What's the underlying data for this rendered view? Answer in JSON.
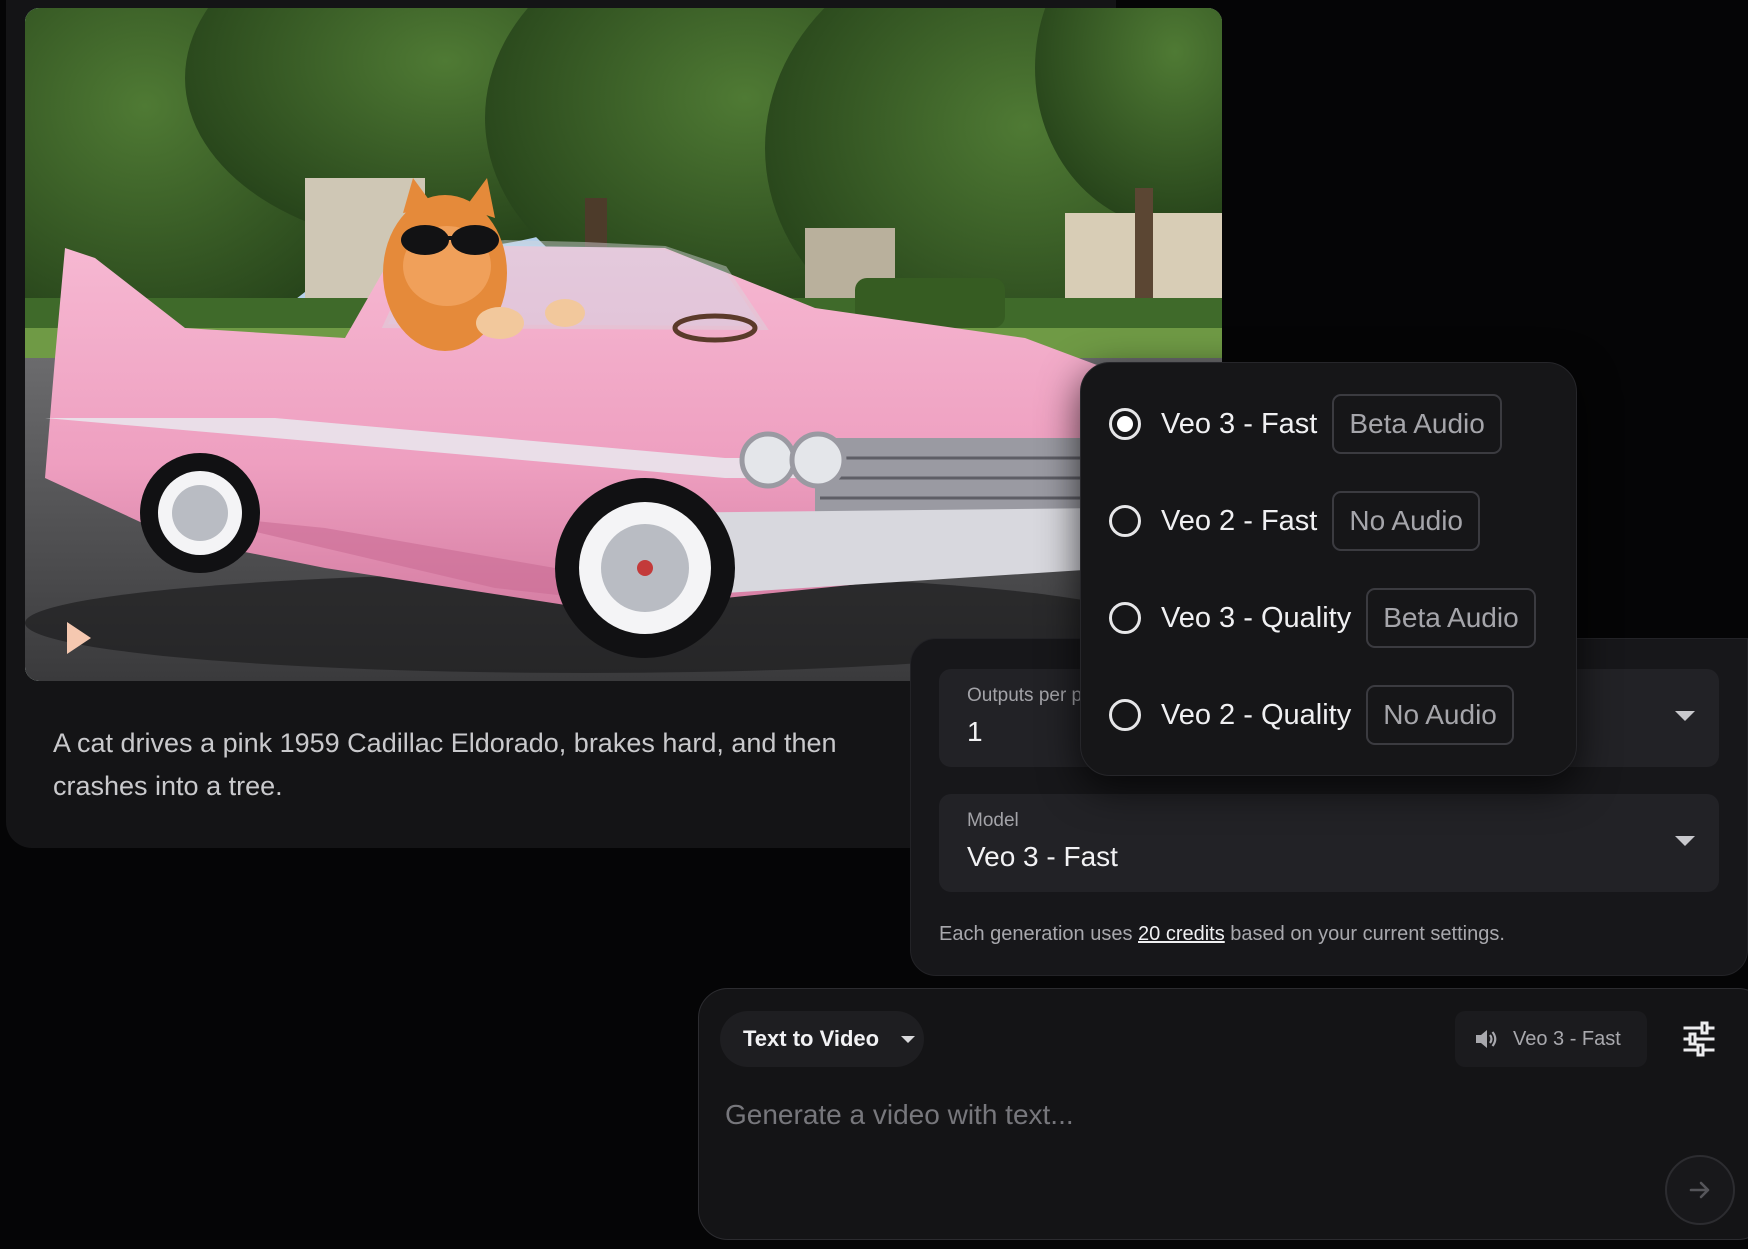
{
  "video_card": {
    "prompt": "A cat drives a pink 1959 Cadillac Eldorado, brakes hard, and then crashes into a tree.",
    "play_icon": "play-icon"
  },
  "settings": {
    "outputs_label": "Outputs per prompt",
    "outputs_value": "1",
    "model_label": "Model",
    "model_value": "Veo 3 - Fast",
    "credits_prefix": "Each generation uses ",
    "credits_link": "20 credits",
    "credits_suffix": " based on your current settings."
  },
  "model_menu": {
    "options": [
      {
        "label": "Veo 3 - Fast",
        "badge": "Beta Audio",
        "selected": true
      },
      {
        "label": "Veo 2 - Fast",
        "badge": "No Audio",
        "selected": false
      },
      {
        "label": "Veo 3 - Quality",
        "badge": "Beta Audio",
        "selected": false
      },
      {
        "label": "Veo 2 - Quality",
        "badge": "No Audio",
        "selected": false
      }
    ]
  },
  "composer": {
    "mode_label": "Text to Video",
    "model_chip_label": "Veo 3 - Fast",
    "placeholder": "Generate a video with text...",
    "icons": {
      "audio": "speaker-icon",
      "settings": "sliders-icon",
      "send": "arrow-right-icon"
    }
  },
  "colors": {
    "background": "#050506",
    "panel": "#17171a",
    "field": "#222226",
    "car_pink": "#f2a9c8"
  }
}
